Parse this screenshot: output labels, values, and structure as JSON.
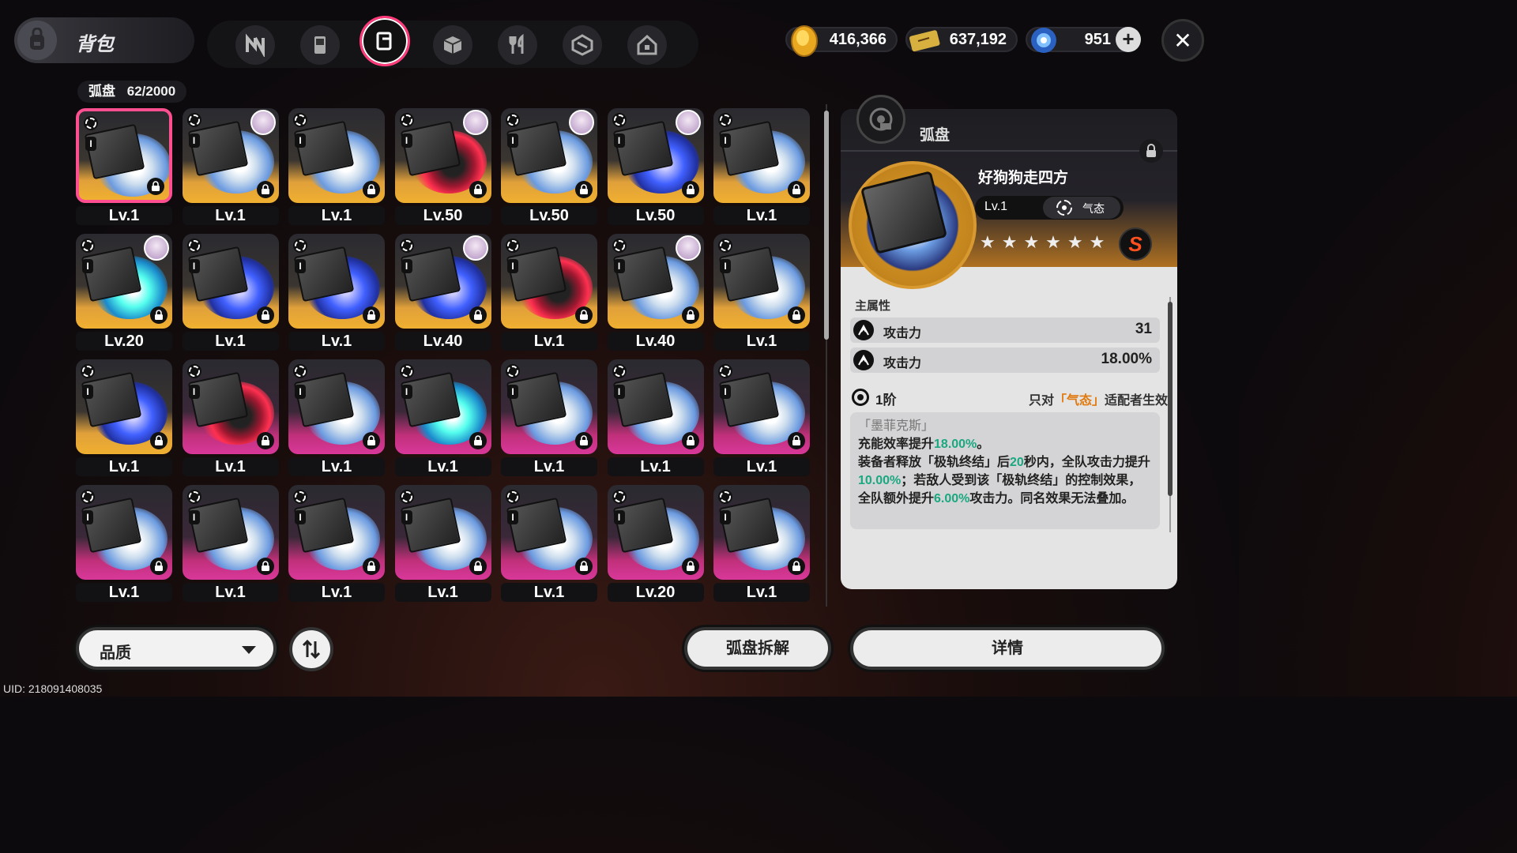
{
  "header": {
    "title": "背包",
    "tabs": [
      {
        "name": "n-tab-icon"
      },
      {
        "name": "device-tab-icon"
      },
      {
        "name": "disc-tab-icon",
        "active": true
      },
      {
        "name": "box-tab-icon"
      },
      {
        "name": "food-tab-icon"
      },
      {
        "name": "cube-tab-icon"
      },
      {
        "name": "home-tab-icon"
      }
    ],
    "currencies": [
      {
        "icon": "gold-coin-icon",
        "value": "416,366"
      },
      {
        "icon": "ticket-icon",
        "value": "637,192"
      },
      {
        "icon": "crystal-icon",
        "value": "951"
      }
    ]
  },
  "inventory": {
    "label": "弧盘",
    "count": "62/2000",
    "items": [
      {
        "level": "Lv.1",
        "rarity": "gold",
        "disc": "white",
        "avatar": false,
        "selected": true
      },
      {
        "level": "Lv.1",
        "rarity": "gold",
        "disc": "white",
        "avatar": true
      },
      {
        "level": "Lv.1",
        "rarity": "gold",
        "disc": "white",
        "avatar": false
      },
      {
        "level": "Lv.50",
        "rarity": "gold",
        "disc": "red",
        "avatar": true
      },
      {
        "level": "Lv.50",
        "rarity": "gold",
        "disc": "white",
        "avatar": true
      },
      {
        "level": "Lv.50",
        "rarity": "gold",
        "disc": "blue",
        "avatar": true
      },
      {
        "level": "Lv.1",
        "rarity": "gold",
        "disc": "white",
        "avatar": false
      },
      {
        "level": "Lv.20",
        "rarity": "gold",
        "disc": "cyan",
        "avatar": true
      },
      {
        "level": "Lv.1",
        "rarity": "gold",
        "disc": "blue",
        "avatar": false
      },
      {
        "level": "Lv.1",
        "rarity": "gold",
        "disc": "blue",
        "avatar": false
      },
      {
        "level": "Lv.40",
        "rarity": "gold",
        "disc": "blue",
        "avatar": true
      },
      {
        "level": "Lv.1",
        "rarity": "gold",
        "disc": "red",
        "avatar": false
      },
      {
        "level": "Lv.40",
        "rarity": "gold",
        "disc": "white",
        "avatar": true
      },
      {
        "level": "Lv.1",
        "rarity": "gold",
        "disc": "white",
        "avatar": false
      },
      {
        "level": "Lv.1",
        "rarity": "gold",
        "disc": "blue",
        "avatar": false
      },
      {
        "level": "Lv.1",
        "rarity": "purple",
        "disc": "red",
        "avatar": false
      },
      {
        "level": "Lv.1",
        "rarity": "purple",
        "disc": "white",
        "avatar": false
      },
      {
        "level": "Lv.1",
        "rarity": "purple",
        "disc": "cyan",
        "avatar": false
      },
      {
        "level": "Lv.1",
        "rarity": "purple",
        "disc": "white",
        "avatar": false
      },
      {
        "level": "Lv.1",
        "rarity": "purple",
        "disc": "white",
        "avatar": false
      },
      {
        "level": "Lv.1",
        "rarity": "purple",
        "disc": "white",
        "avatar": false
      },
      {
        "level": "Lv.1",
        "rarity": "purple",
        "disc": "white",
        "avatar": false
      },
      {
        "level": "Lv.1",
        "rarity": "purple",
        "disc": "white",
        "avatar": false
      },
      {
        "level": "Lv.1",
        "rarity": "purple",
        "disc": "white",
        "avatar": false
      },
      {
        "level": "Lv.1",
        "rarity": "purple",
        "disc": "white",
        "avatar": false
      },
      {
        "level": "Lv.1",
        "rarity": "purple",
        "disc": "white",
        "avatar": false
      },
      {
        "level": "Lv.20",
        "rarity": "purple",
        "disc": "white",
        "avatar": false
      },
      {
        "level": "Lv.1",
        "rarity": "purple",
        "disc": "white",
        "avatar": false
      }
    ]
  },
  "detail": {
    "label": "弧盘",
    "name": "好狗狗走四方",
    "level": "Lv.1",
    "attribute": "气态",
    "stars": "★★★★★★",
    "rank": "S",
    "main_stats_title": "主属性",
    "stats": [
      {
        "name": "攻击力",
        "value": "31"
      },
      {
        "name": "攻击力",
        "value": "18.00%"
      }
    ],
    "skill_rank": "1阶",
    "condition_pre": "只对",
    "condition_hl": "「气态」",
    "condition_post": "适配者生效",
    "skill_name": "「墨菲克斯」",
    "desc1_a": "充能效率提升",
    "desc1_b": "18.00%",
    "desc1_c": "。",
    "desc2_a": "装备者释放「极轨终结」后",
    "desc2_b": "20",
    "desc2_c": "秒内，全队攻击力提升",
    "desc2_d": "10.00%",
    "desc2_e": "；若敌人受到该「极轨终结」的控制效果，全队额外提升",
    "desc2_f": "6.00%",
    "desc2_g": "攻击力。同名效果无法叠加。"
  },
  "footer": {
    "quality_label": "品质",
    "dismantle_label": "弧盘拆解",
    "details_label": "详情",
    "uid": "UID: 218091408035"
  },
  "colors": {
    "accent": "#ff4f90",
    "gold": "#f0b030",
    "purple": "#d8389a",
    "highlight_green": "#1aa880",
    "highlight_orange": "#e07a10"
  }
}
